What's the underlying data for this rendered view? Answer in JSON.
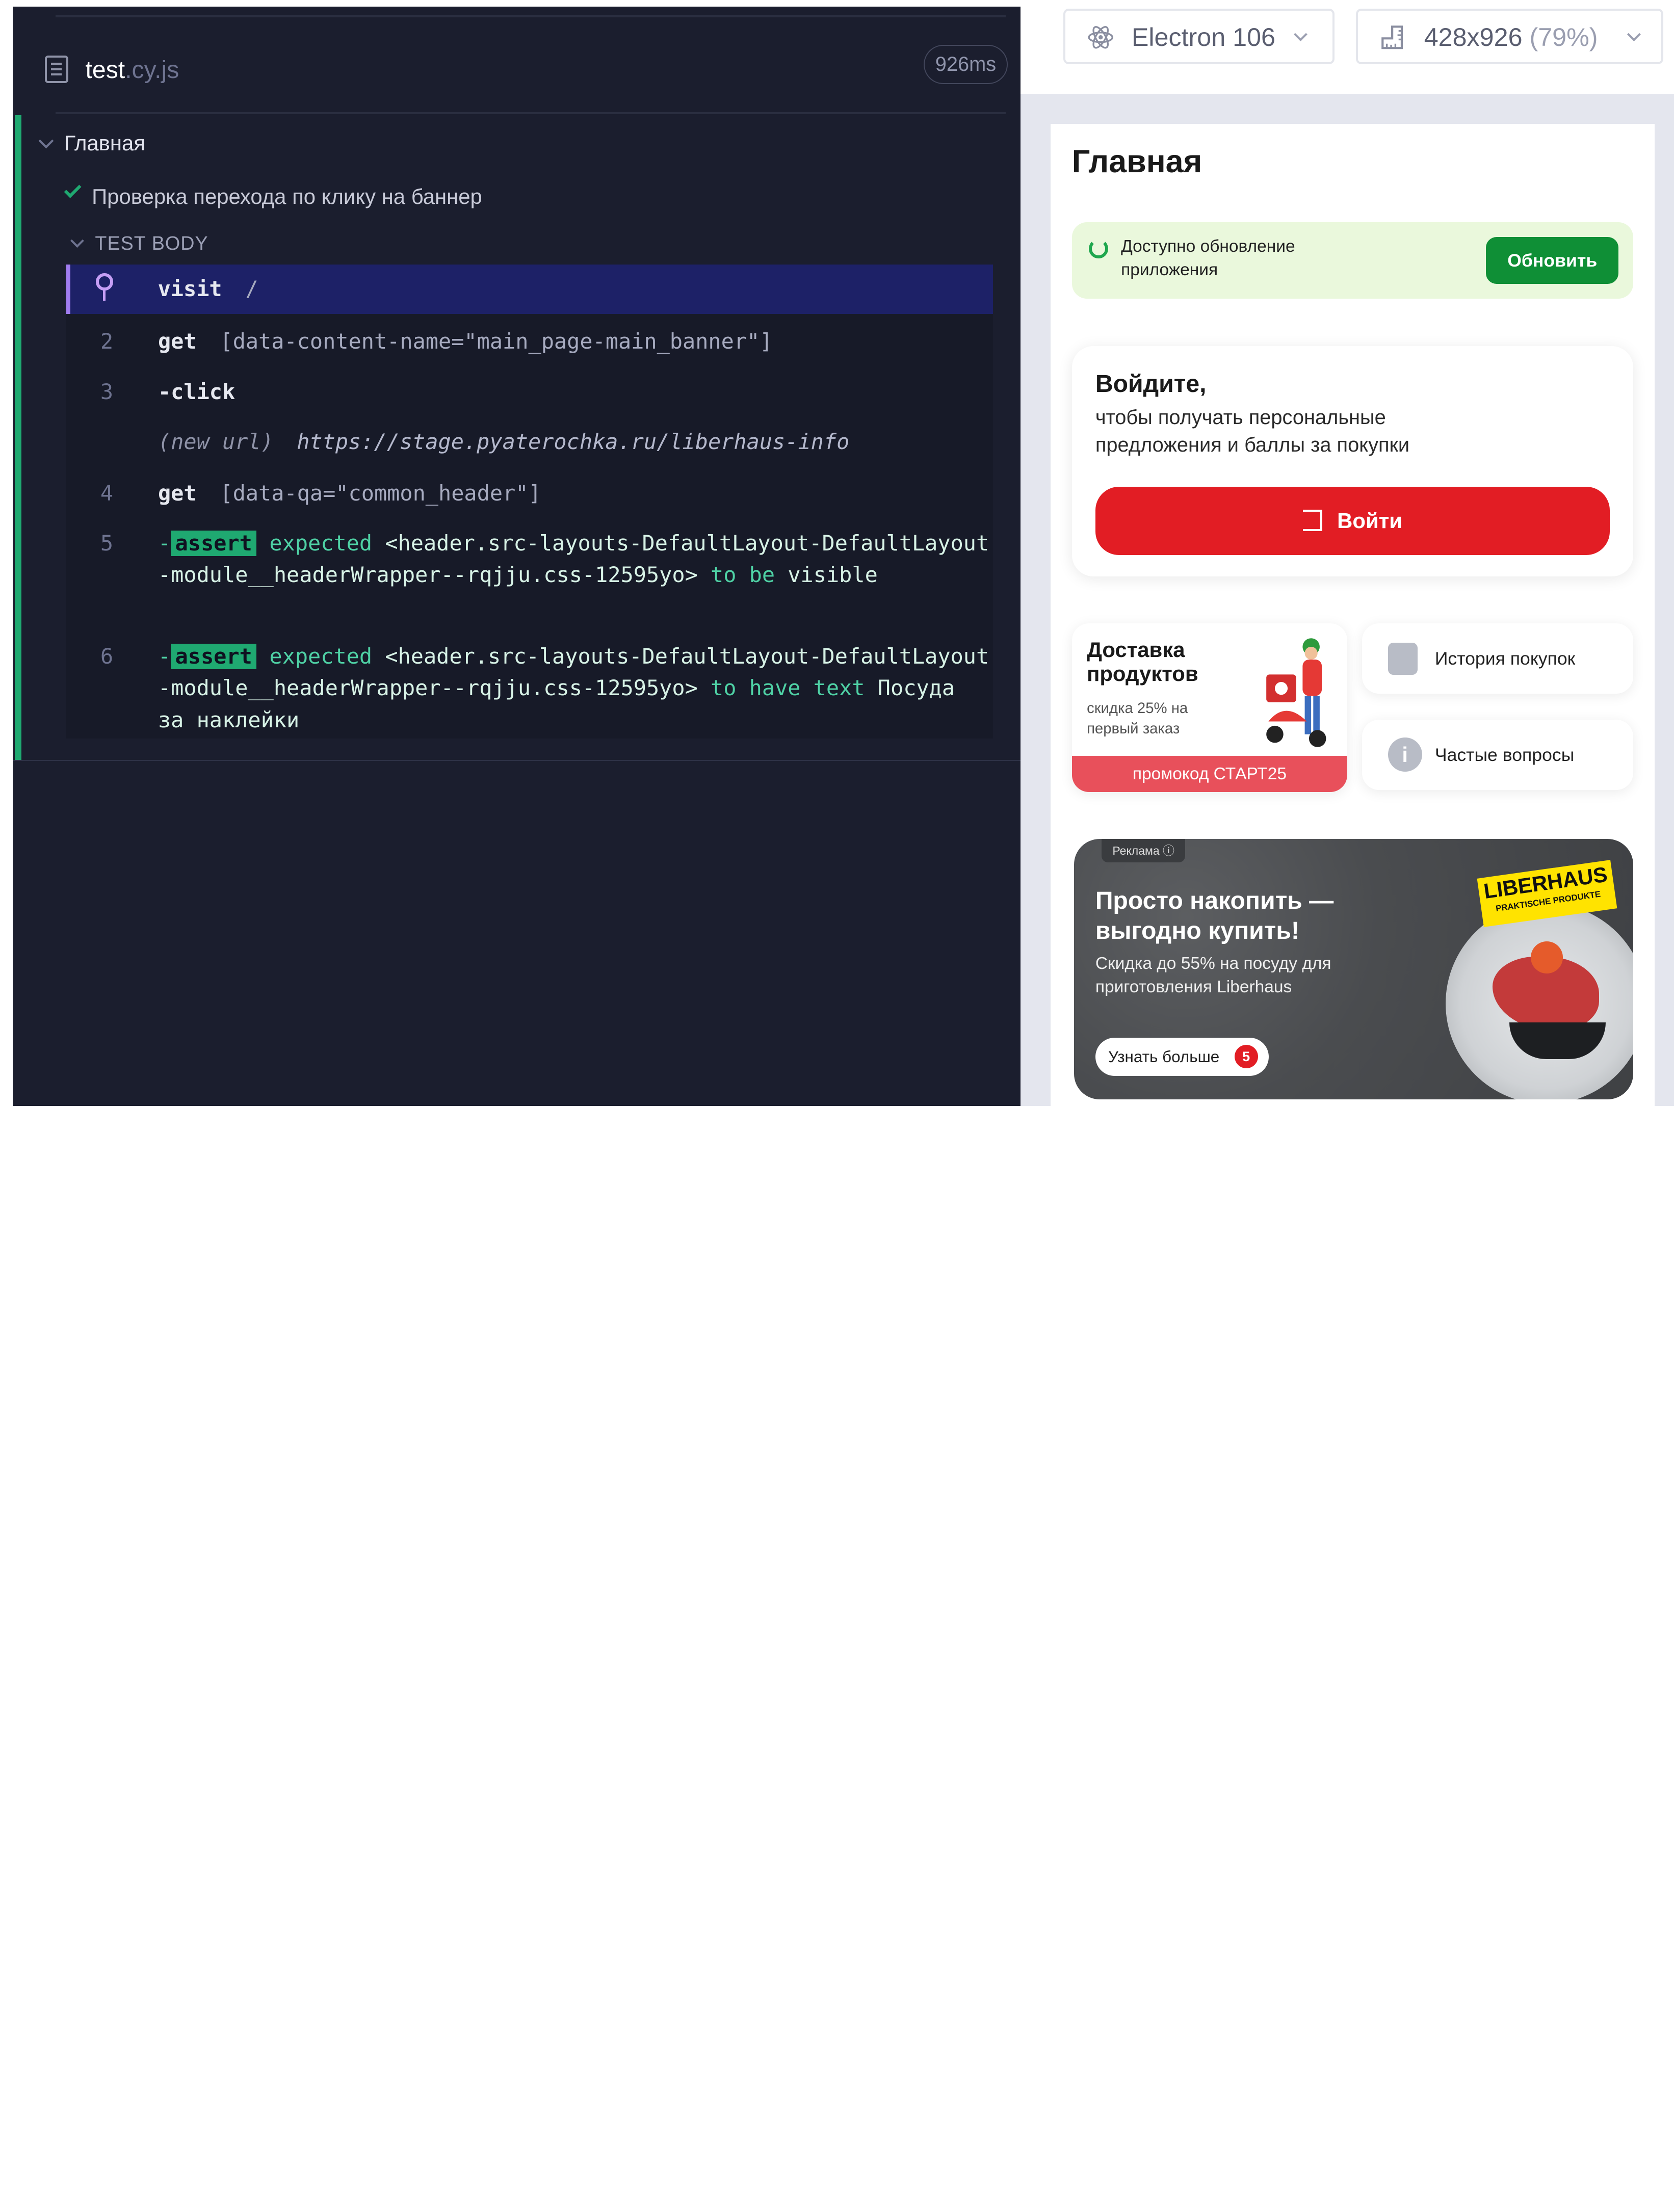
{
  "runner": {
    "spec": {
      "name": "test",
      "ext": ".cy.js",
      "duration": "926ms"
    },
    "suite": "Главная",
    "test": "Проверка перехода по клику на баннер",
    "section": "TEST BODY",
    "commands": [
      {
        "num": "",
        "name": "visit",
        "msg": "/"
      },
      {
        "num": "2",
        "name": "get",
        "msg": "[data-content-name=\"main_page-main_banner\"]"
      },
      {
        "num": "3",
        "name": "-click",
        "msg": ""
      },
      {
        "num": "",
        "name": "(new url)",
        "msg": "https://stage.pyaterochka.ru/liberhaus-info"
      },
      {
        "num": "4",
        "name": "get",
        "msg": "[data-qa=\"common_header\"]"
      },
      {
        "num": "5",
        "prefix": "-",
        "badge": "assert",
        "expected": "expected",
        "subject": "<header.src-layouts-DefaultLayout-DefaultLayout-module__headerWrapper--rqjju.css-12595yo>",
        "matcher": "to be",
        "value": "visible"
      },
      {
        "num": "6",
        "prefix": "-",
        "badge": "assert",
        "expected": "expected",
        "subject": "<header.src-layouts-DefaultLayout-DefaultLayout-module__headerWrapper--rqjju.css-12595yo>",
        "matcher": "to have text",
        "value": "Посуда за наклейки"
      }
    ]
  },
  "topbar": {
    "browser": {
      "label": "Electron 106",
      "icon": "electron-icon"
    },
    "viewport": {
      "label": "428x926",
      "scale": "(79%)",
      "icon": "ruler-icon"
    }
  },
  "app": {
    "title": "Главная",
    "update": {
      "text": "Доступно обновление приложения",
      "button": "Обновить"
    },
    "login": {
      "title": "Войдите,",
      "subtitle": "чтобы получать персональные предложения и баллы за покупки",
      "button": "Войти"
    },
    "delivery": {
      "title": "Доставка продуктов",
      "subtitle": "скидка 25% на первый заказ",
      "promo": "промокод СТАРТ25"
    },
    "history": "История покупок",
    "faq": "Частые вопросы",
    "ad": {
      "tag": "Реклама ⓘ",
      "title": "Просто накопить — выгодно купить!",
      "subtitle": "Скидка до 55% на посуду для приготовления Liberhaus",
      "button": "Узнать больше",
      "brand": "LIBERHAUS",
      "brand_sub": "PRAKTISCHE PRODUKTE"
    }
  },
  "colors": {
    "pass": "#1fa971",
    "runner_bg": "#1b1e2e",
    "active_row": "#1d2167",
    "brand_red": "#e21d24",
    "brand_green": "#0f8f36"
  }
}
